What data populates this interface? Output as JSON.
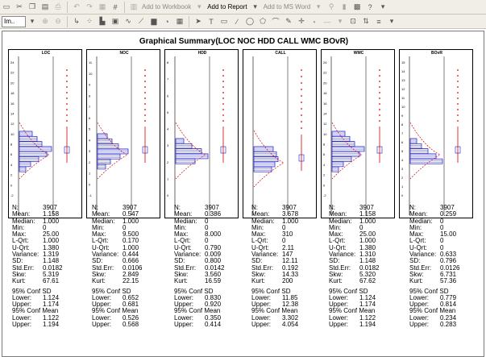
{
  "toolbar1": {
    "add_to_workbook": "Add to Workbook",
    "add_to_report": "Add to Report",
    "add_to_ms_word": "Add to MS Word"
  },
  "toolbar2": {
    "font_combo": "Im.."
  },
  "graph": {
    "title": "Graphical Summary(LOC NOC HDD CALL WMC BOvR)",
    "panels": [
      {
        "name": "LOC",
        "label": "LOC",
        "ticks": [
          "24",
          "22",
          "20",
          "18",
          "16",
          "14",
          "12",
          "10",
          "8",
          "6",
          "4",
          "2",
          "0",
          "-2"
        ],
        "stats": [
          [
            "N:",
            "3907"
          ],
          [
            "Mean:",
            "1.158"
          ],
          [
            "Median:",
            "1.000"
          ],
          [
            "Min:",
            "0"
          ],
          [
            "Max:",
            "25.00"
          ],
          [
            "L-Qrt:",
            "1.000"
          ],
          [
            "U-Qrt:",
            "1.380"
          ],
          [
            "Variance:",
            "1.319"
          ],
          [
            "SD:",
            "1.148"
          ],
          [
            "Std.Err:",
            "0.0182"
          ],
          [
            "Skw:",
            "5.319"
          ],
          [
            "Kurt:",
            "67.61"
          ]
        ],
        "ci_sd": "95% Conf SD",
        "sd_lower": [
          "Lower:",
          "1.124"
        ],
        "sd_upper": [
          "Upper:",
          "1.174"
        ],
        "ci_mean": "95% Conf Mean",
        "mean_lower": [
          "Lower:",
          "1.122"
        ],
        "mean_upper": [
          "Upper:",
          "1.194"
        ]
      },
      {
        "name": "NOC",
        "label": "NOC",
        "ticks": [
          "11",
          "10",
          "9",
          "8",
          "7",
          "6",
          "5",
          "4",
          "3",
          "2",
          "1",
          "0",
          "-1"
        ],
        "stats": [
          [
            "N:",
            "3907"
          ],
          [
            "Mean:",
            "0.547"
          ],
          [
            "Median:",
            "1.000"
          ],
          [
            "Min:",
            "0"
          ],
          [
            "Max:",
            "9.500"
          ],
          [
            "L-Qrt:",
            "0.170"
          ],
          [
            "U-Qrt:",
            "1.000"
          ],
          [
            "Variance:",
            "0.444"
          ],
          [
            "SD:",
            "0.666"
          ],
          [
            "Std.Err:",
            "0.0106"
          ],
          [
            "Skw:",
            "2.849"
          ],
          [
            "Kurt:",
            "22.15"
          ]
        ],
        "ci_sd": "95% Conf SD",
        "sd_lower": [
          "Lower:",
          "0.652"
        ],
        "sd_upper": [
          "Upper:",
          "0.681"
        ],
        "ci_mean": "95% Conf Mean",
        "mean_lower": [
          "Lower:",
          "0.526"
        ],
        "mean_upper": [
          "Upper:",
          "0.568"
        ]
      },
      {
        "name": "HDD",
        "label": "HDD",
        "ticks": [
          "8",
          "7",
          "6",
          "5",
          "4",
          "3",
          "2",
          "1",
          "0"
        ],
        "stats": [
          [
            "N:",
            "3907"
          ],
          [
            "Mean:",
            "0.386"
          ],
          [
            "Median:",
            "0"
          ],
          [
            "Min:",
            "0"
          ],
          [
            "Max:",
            "8.000"
          ],
          [
            "L-Qrt:",
            "0"
          ],
          [
            "U-Qrt:",
            "0.790"
          ],
          [
            "Variance:",
            "0.009"
          ],
          [
            "SD:",
            "0.800"
          ],
          [
            "Std.Err:",
            "0.0142"
          ],
          [
            "Skw:",
            "3.560"
          ],
          [
            "Kurt:",
            "16.59"
          ]
        ],
        "ci_sd": "95% Conf SD",
        "sd_lower": [
          "Lower:",
          "0.830"
        ],
        "sd_upper": [
          "Upper:",
          "0.920"
        ],
        "ci_mean": "95% Conf Mean",
        "mean_lower": [
          "Lower:",
          "0.350"
        ],
        "mean_upper": [
          "Upper:",
          "0.414"
        ]
      },
      {
        "name": "CALL",
        "label": "CALL",
        "ticks": [],
        "stats": [
          [
            "N:",
            "3907"
          ],
          [
            "Mean:",
            "3.678"
          ],
          [
            "Median:",
            "1.000"
          ],
          [
            "Min:",
            "0"
          ],
          [
            "Max:",
            "310"
          ],
          [
            "L-Qrt:",
            "0"
          ],
          [
            "U-Qrt:",
            "2.11"
          ],
          [
            "Variance:",
            "147"
          ],
          [
            "SD:",
            "12.11"
          ],
          [
            "Std.Err:",
            "0.192"
          ],
          [
            "Skw:",
            "14.33"
          ],
          [
            "Kurt:",
            "200"
          ]
        ],
        "ci_sd": "95% Conf SD",
        "sd_lower": [
          "Lower:",
          "11.85"
        ],
        "sd_upper": [
          "Upper:",
          "12.38"
        ],
        "ci_mean": "95% Conf Mean",
        "mean_lower": [
          "Lower:",
          "3.302"
        ],
        "mean_upper": [
          "Upper:",
          "4.054"
        ]
      },
      {
        "name": "WMC",
        "label": "WMC",
        "ticks": [
          "24",
          "22",
          "20",
          "18",
          "16",
          "14",
          "12",
          "10",
          "8",
          "6",
          "4",
          "2",
          "0",
          "-2"
        ],
        "stats": [
          [
            "N:",
            "3907"
          ],
          [
            "Mean:",
            "1.158"
          ],
          [
            "Median:",
            "1.000"
          ],
          [
            "Min:",
            "0"
          ],
          [
            "Max:",
            "25.00"
          ],
          [
            "L-Qrt:",
            "1.000"
          ],
          [
            "U-Qrt:",
            "1.380"
          ],
          [
            "Variance:",
            "1.310"
          ],
          [
            "SD:",
            "1.148"
          ],
          [
            "Std.Err:",
            "0.0182"
          ],
          [
            "Skw:",
            "5.320"
          ],
          [
            "Kurt:",
            "67.62"
          ]
        ],
        "ci_sd": "95% Conf SD",
        "sd_lower": [
          "Lower:",
          "1.124"
        ],
        "sd_upper": [
          "Upper:",
          "1.174"
        ],
        "ci_mean": "95% Conf Mean",
        "mean_lower": [
          "Lower:",
          "1.122"
        ],
        "mean_upper": [
          "Upper:",
          "1.194"
        ]
      },
      {
        "name": "BOvR",
        "label": "BOvR",
        "ticks": [
          "15",
          "14",
          "13",
          "12",
          "11",
          "10",
          "9",
          "8",
          "7",
          "6",
          "5",
          "4",
          "3",
          "2",
          "1",
          "0"
        ],
        "stats": [
          [
            "N:",
            "3907"
          ],
          [
            "Mean:",
            "0.259"
          ],
          [
            "Median:",
            "0"
          ],
          [
            "Min:",
            "0"
          ],
          [
            "Max:",
            "15.00"
          ],
          [
            "L-Qrt:",
            "0"
          ],
          [
            "U-Qrt:",
            "0"
          ],
          [
            "Variance:",
            "0.633"
          ],
          [
            "SD:",
            "0.796"
          ],
          [
            "Std.Err:",
            "0.0126"
          ],
          [
            "Skw:",
            "6.731"
          ],
          [
            "Kurt:",
            "57.36"
          ]
        ],
        "ci_sd": "95% Conf SD",
        "sd_lower": [
          "Lower:",
          "0.779"
        ],
        "sd_upper": [
          "Upper:",
          "0.814"
        ],
        "ci_mean": "95% Conf Mean",
        "mean_lower": [
          "Lower:",
          "0.234"
        ],
        "mean_upper": [
          "Upper:",
          "0.283"
        ]
      }
    ]
  },
  "colors": {
    "hist": "#1a1acc",
    "curve": "#d40000",
    "toolbar": "#f0eee6"
  }
}
